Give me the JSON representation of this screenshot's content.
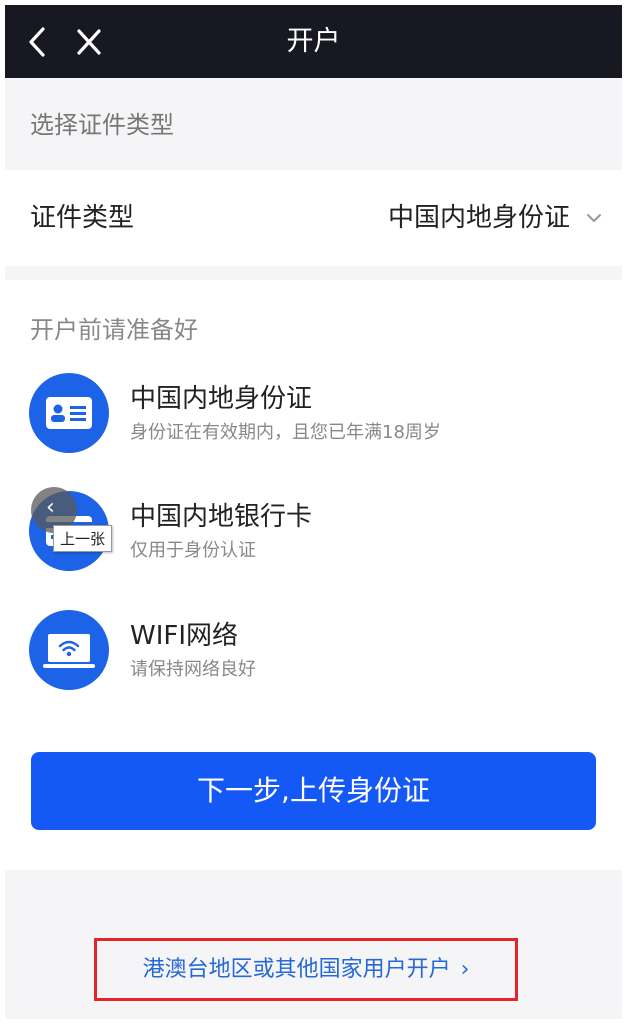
{
  "header": {
    "title": "开户",
    "back_icon": "chevron-left-icon",
    "close_icon": "close-icon"
  },
  "id_section": {
    "heading": "选择证件类型",
    "row_label": "证件类型",
    "selected_value": "中国内地身份证"
  },
  "prepare": {
    "heading": "开户前请准备好",
    "items": [
      {
        "title": "中国内地身份证",
        "desc": "身份证在有效期内，且您已年满18周岁",
        "icon": "id-card-icon"
      },
      {
        "title": "中国内地银行卡",
        "desc": "仅用于身份认证",
        "icon": "bank-card-icon"
      },
      {
        "title": "WIFI网络",
        "desc": "请保持网络良好",
        "icon": "wifi-laptop-icon"
      }
    ]
  },
  "overlay": {
    "prev_label": "上一张"
  },
  "next_button": "下一步,上传身份证",
  "other_region_link": {
    "label": "港澳台地区或其他国家用户开户",
    "arrow": "›"
  },
  "colors": {
    "topbar": "#171821",
    "primary": "#1458f5",
    "icon_bg": "#1c63e8",
    "link": "#2668d8",
    "highlight_border": "#e0252d"
  }
}
